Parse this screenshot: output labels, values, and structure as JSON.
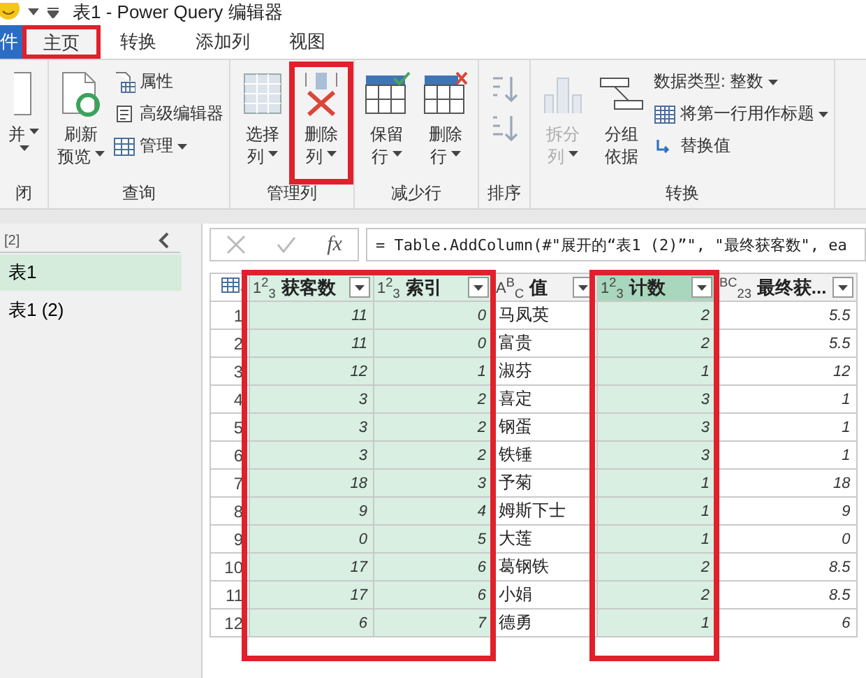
{
  "window": {
    "title": "表1 - Power Query 编辑器"
  },
  "tabs": [
    {
      "label": "件",
      "kind": "file",
      "selected": false,
      "highlighted": false
    },
    {
      "label": "主页",
      "kind": "tab",
      "selected": true,
      "highlighted": true
    },
    {
      "label": "转换",
      "kind": "tab",
      "selected": false,
      "highlighted": false
    },
    {
      "label": "添加列",
      "kind": "tab",
      "selected": false,
      "highlighted": false
    },
    {
      "label": "视图",
      "kind": "tab",
      "selected": false,
      "highlighted": false
    }
  ],
  "ribbon": {
    "groups": [
      {
        "label": "闭",
        "items": [
          {
            "kind": "large",
            "lines": [
              "并"
            ],
            "caret": true,
            "disabled": false,
            "highlighted": false
          }
        ]
      },
      {
        "label": "查询",
        "items": [
          {
            "kind": "large",
            "lines": [
              "刷新",
              "预览"
            ],
            "caret": true,
            "disabled": false,
            "highlighted": false
          },
          {
            "kind": "stack",
            "entries": [
              {
                "label": "属性",
                "caret": false
              },
              {
                "label": "高级编辑器",
                "caret": false
              },
              {
                "label": "管理",
                "caret": true
              }
            ]
          }
        ]
      },
      {
        "label": "管理列",
        "items": [
          {
            "kind": "large",
            "lines": [
              "选择",
              "列"
            ],
            "caret": true,
            "disabled": false,
            "highlighted": false
          },
          {
            "kind": "large",
            "lines": [
              "删除",
              "列"
            ],
            "caret": true,
            "disabled": false,
            "highlighted": true
          }
        ]
      },
      {
        "label": "减少行",
        "items": [
          {
            "kind": "large",
            "lines": [
              "保留",
              "行"
            ],
            "caret": true,
            "disabled": false,
            "highlighted": false
          },
          {
            "kind": "large",
            "lines": [
              "删除",
              "行"
            ],
            "caret": true,
            "disabled": false,
            "highlighted": false
          }
        ]
      },
      {
        "label": "排序",
        "items": [
          {
            "kind": "icons"
          }
        ]
      },
      {
        "label": "转换",
        "items": [
          {
            "kind": "large",
            "lines": [
              "拆分",
              "列"
            ],
            "caret": true,
            "disabled": true,
            "highlighted": false
          },
          {
            "kind": "large",
            "lines": [
              "分组",
              "依据"
            ],
            "caret": false,
            "disabled": false,
            "highlighted": false
          },
          {
            "kind": "stack",
            "entries": [
              {
                "label": "数据类型: 整数",
                "caret": true
              },
              {
                "label": "将第一行用作标题",
                "caret": true
              },
              {
                "label": "替换值",
                "caret": false
              }
            ]
          }
        ]
      }
    ]
  },
  "queries": {
    "count": "[2]",
    "items": [
      {
        "label": "表1",
        "selected": true
      },
      {
        "label": "表1 (2)",
        "selected": false
      }
    ]
  },
  "formula_bar": {
    "function_label": "fx",
    "formula": "= Table.AddColumn(#\"展开的“表1 (2)”\", \"最终获客数\", ea"
  },
  "table": {
    "columns": [
      {
        "type": "1$^{2}$$_{3}$",
        "name": "获客数",
        "kind": "number",
        "selected": true,
        "active": false,
        "highlighted": true
      },
      {
        "type": "1$^{2}$$_{3}$",
        "name": "索引",
        "kind": "number",
        "selected": true,
        "active": false,
        "highlighted": true
      },
      {
        "type": "A$^{B}$$_{C}$",
        "name": "值",
        "kind": "text",
        "selected": false,
        "active": false,
        "highlighted": false
      },
      {
        "type": "1$^{2}$$_{3}$",
        "name": "计数",
        "kind": "number",
        "selected": true,
        "active": true,
        "highlighted": true
      },
      {
        "type": "$^{BC}$$_{23}$",
        "name": "最终获...",
        "kind": "number",
        "selected": false,
        "active": false,
        "highlighted": false
      }
    ],
    "rows": [
      {
        "number": "1",
        "cells": [
          "11",
          "0",
          "马凤英",
          "2",
          "5.5"
        ]
      },
      {
        "number": "2",
        "cells": [
          "11",
          "0",
          "富贵",
          "2",
          "5.5"
        ]
      },
      {
        "number": "3",
        "cells": [
          "12",
          "1",
          "淑芬",
          "1",
          "12"
        ]
      },
      {
        "number": "4",
        "cells": [
          "3",
          "2",
          "喜定",
          "3",
          "1"
        ]
      },
      {
        "number": "5",
        "cells": [
          "3",
          "2",
          "钢蛋",
          "3",
          "1"
        ]
      },
      {
        "number": "6",
        "cells": [
          "3",
          "2",
          "铁锤",
          "3",
          "1"
        ]
      },
      {
        "number": "7",
        "cells": [
          "18",
          "3",
          "予菊",
          "1",
          "18"
        ]
      },
      {
        "number": "8",
        "cells": [
          "9",
          "4",
          "姆斯下士",
          "1",
          "9"
        ]
      },
      {
        "number": "9",
        "cells": [
          "0",
          "5",
          "大莲",
          "1",
          "0"
        ]
      },
      {
        "number": "10",
        "cells": [
          "17",
          "6",
          "葛钢铁",
          "2",
          "8.5"
        ]
      },
      {
        "number": "11",
        "cells": [
          "17",
          "6",
          "小娟",
          "2",
          "8.5"
        ]
      },
      {
        "number": "12",
        "cells": [
          "6",
          "7",
          "德勇",
          "1",
          "6"
        ]
      }
    ]
  }
}
